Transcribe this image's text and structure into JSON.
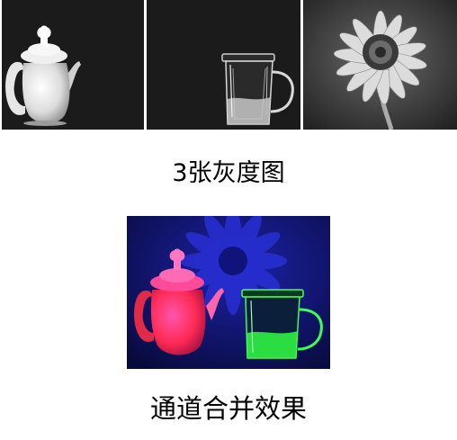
{
  "images": {
    "grayscale": [
      {
        "subject": "teapot",
        "channel": "red"
      },
      {
        "subject": "glass-cup",
        "channel": "green"
      },
      {
        "subject": "flower",
        "channel": "blue"
      }
    ],
    "merged": {
      "subject": "teapot-glass-flower-composite"
    }
  },
  "captions": {
    "grayscale_label": "3张灰度图",
    "merged_label": "通道合并效果"
  },
  "colors": {
    "background": "#ffffff",
    "photo_background": "#1b1b1b",
    "teapot_merged": "#ff2a55",
    "glass_merged": "#33ff44",
    "flower_merged": "#2a30d8"
  }
}
